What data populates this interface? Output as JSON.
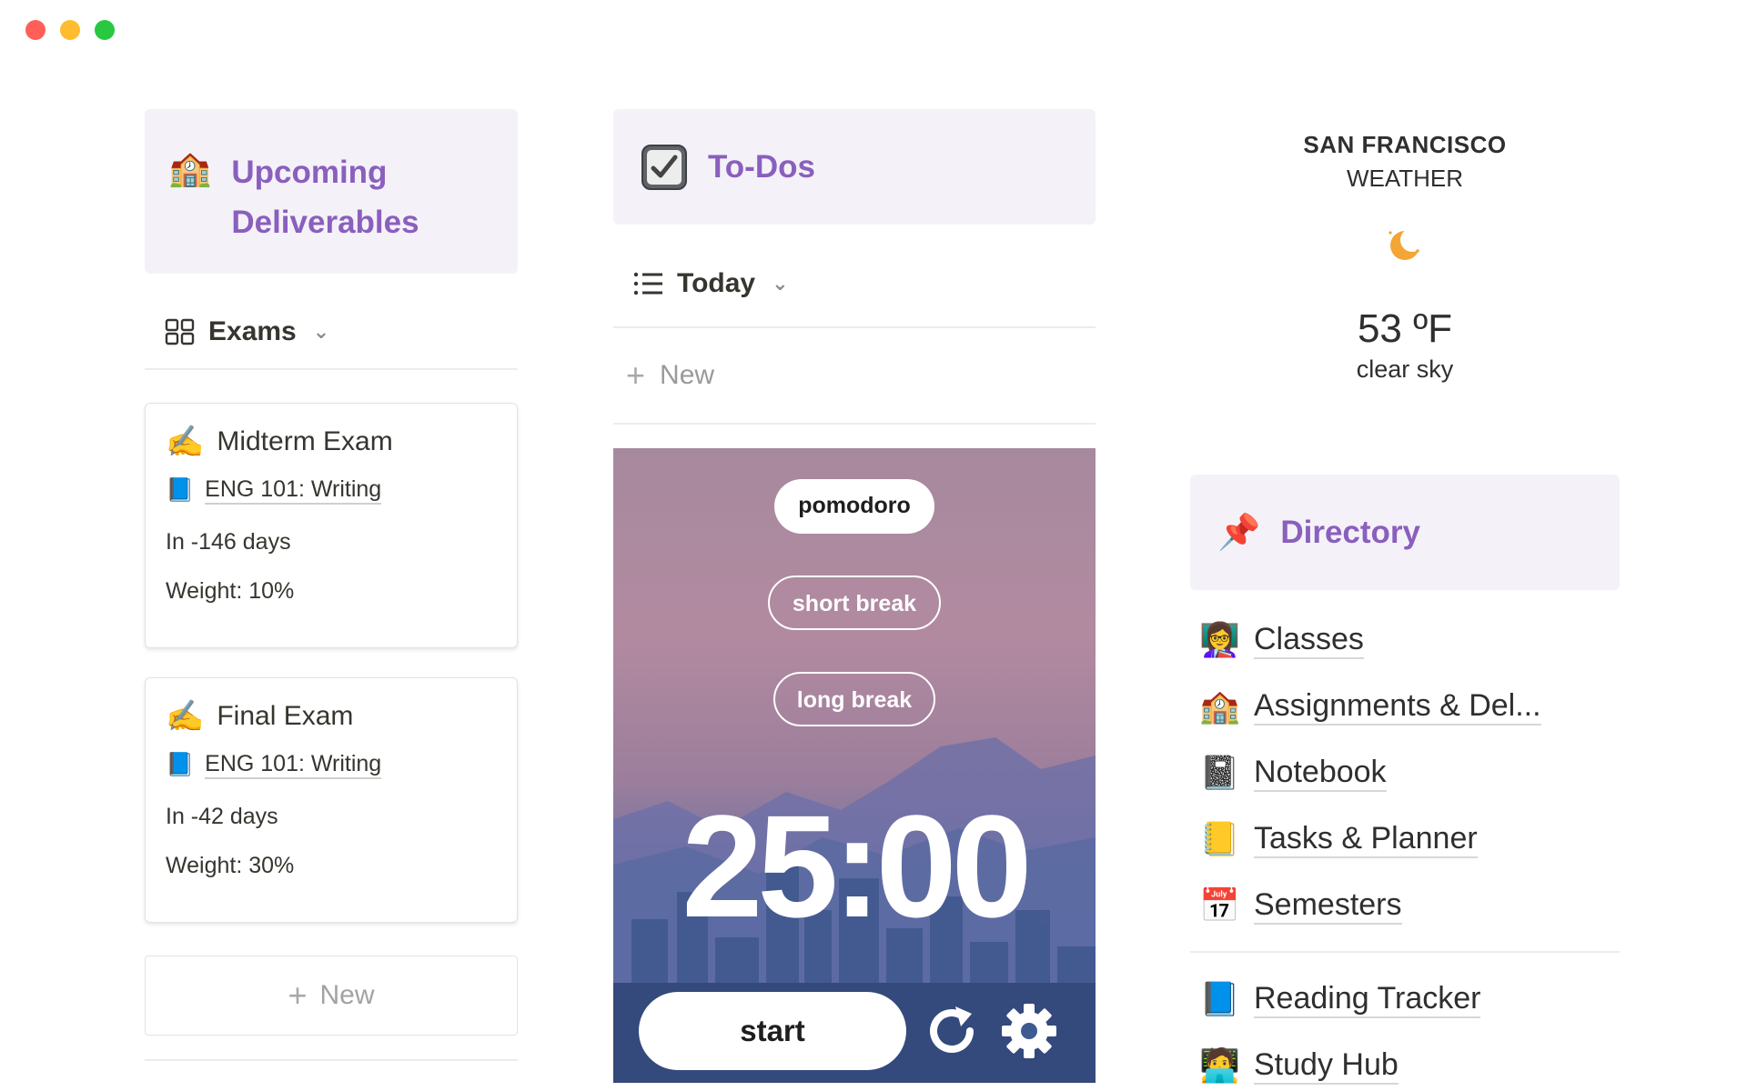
{
  "window": {
    "controls": {
      "close_color": "#ff5f57",
      "minimize_color": "#febc2e",
      "maximize_color": "#28c840"
    }
  },
  "deliverables": {
    "icon": "🏫",
    "title_line1": "Upcoming",
    "title_line2": "Deliverables",
    "view_label": "Exams",
    "cards": [
      {
        "icon": "✍️",
        "title": "Midterm Exam",
        "course_icon": "📘",
        "course": "ENG 101: Writing",
        "due": "In -146 days",
        "weight": "Weight: 10%"
      },
      {
        "icon": "✍️",
        "title": "Final Exam",
        "course_icon": "📘",
        "course": "ENG 101: Writing",
        "due": "In -42 days",
        "weight": "Weight: 30%"
      }
    ],
    "new_label": "New"
  },
  "todos": {
    "icon": "checkbox-icon",
    "title": "To-Dos",
    "view_label": "Today",
    "new_label": "New"
  },
  "pomodoro": {
    "mode_pomodoro": "pomodoro",
    "mode_short": "short break",
    "mode_long": "long break",
    "timer": "25:00",
    "start_label": "start"
  },
  "weather": {
    "city": "SAN FRANCISCO",
    "label": "WEATHER",
    "icon": "moon-icon",
    "temp": "53 ºF",
    "desc": "clear sky"
  },
  "directory": {
    "icon": "📌",
    "title": "Directory",
    "items": [
      {
        "icon": "👩‍🏫",
        "label": "Classes"
      },
      {
        "icon": "🏫",
        "label": "Assignments & Del..."
      },
      {
        "icon": "📓",
        "label": "Notebook"
      },
      {
        "icon": "📒",
        "label": "Tasks & Planner"
      },
      {
        "icon": "📅",
        "label": "Semesters"
      }
    ],
    "items2": [
      {
        "icon": "📘",
        "label": "Reading Tracker"
      },
      {
        "icon": "🧑‍💻",
        "label": "Study Hub"
      }
    ]
  }
}
